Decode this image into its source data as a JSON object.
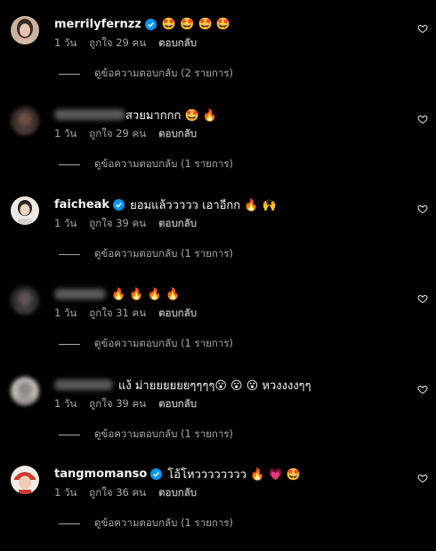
{
  "comments": [
    {
      "username": "merrilyfernzz",
      "verified": true,
      "blurred": false,
      "avatar_icon": "avatar-woman-dark-hair",
      "text": "🤩 🤩 🤩 🤩",
      "time": "1 วัน",
      "likes": "ถูกใจ 29 คน",
      "reply_label": "ตอบกลับ",
      "view_replies": "ดูข้อความตอบกลับ (2 รายการ)"
    },
    {
      "username": "",
      "verified": false,
      "blurred": true,
      "avatar_icon": "avatar-blurred",
      "text": "สวยมากกก 🤩 🔥",
      "time": "1 วัน",
      "likes": "ถูกใจ 29 คน",
      "reply_label": "ตอบกลับ",
      "view_replies": "ดูข้อความตอบกลับ (1 รายการ)"
    },
    {
      "username": "faicheak",
      "verified": true,
      "blurred": false,
      "avatar_icon": "avatar-woman-light",
      "text": "ยอมแล้ววววว เอาอีกก 🔥 🙌",
      "time": "1 วัน",
      "likes": "ถูกใจ 39 คน",
      "reply_label": "ตอบกลับ",
      "view_replies": "ดูข้อความตอบกลับ (1 รายการ)"
    },
    {
      "username": "",
      "verified": false,
      "blurred": true,
      "avatar_icon": "avatar-blurred",
      "text": "🔥 🔥 🔥 🔥",
      "time": "1 วัน",
      "likes": "ถูกใจ 31 คน",
      "reply_label": "ตอบกลับ",
      "view_replies": "ดูข้อความตอบกลับ (1 รายการ)"
    },
    {
      "username": "",
      "verified": false,
      "blurred": true,
      "avatar_icon": "avatar-blurred",
      "text": "แง้ ม่ายยยยยยๆๆๆๆ😮 😮 😮 หวงงงงๆๆ",
      "time": "1 วัน",
      "likes": "ถูกใจ 39 คน",
      "reply_label": "ตอบกลับ",
      "view_replies": "ดูข้อความตอบกลับ (1 รายการ)"
    },
    {
      "username": "tangmomanso",
      "verified": true,
      "blurred": false,
      "avatar_icon": "avatar-woman-red-hat",
      "text": "โอ้โหวววววววว 🔥 💗 🤩",
      "time": "1 วัน",
      "likes": "ถูกใจ 36 คน",
      "reply_label": "ตอบกลับ",
      "view_replies": "ดูข้อความตอบกลับ (1 รายการ)"
    }
  ],
  "colors": {
    "background": "#000000",
    "primary_text": "#f5f5f5",
    "secondary_text": "#a8a8a8",
    "verified_badge": "#0095f6"
  }
}
